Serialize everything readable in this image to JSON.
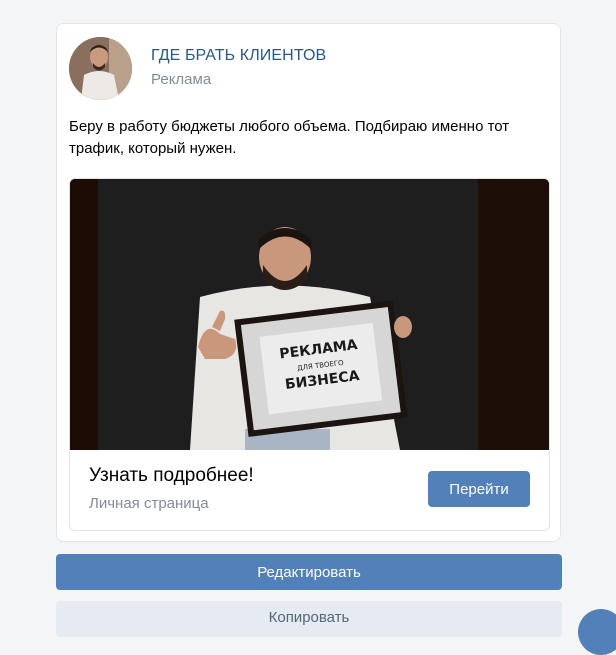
{
  "post": {
    "author": "ГДЕ БРАТЬ КЛИЕНТОВ",
    "label": "Реклама",
    "text": "Беру в работу бюджеты любого объема. Подбираю именно тот трафик, который нужен."
  },
  "ad_image": {
    "sign_line1": "РЕКЛАМА",
    "sign_line2": "ДЛЯ ТВОЕГО",
    "sign_line3": "БИЗНЕСА"
  },
  "cta": {
    "title": "Узнать подробнее!",
    "subtitle": "Личная страница",
    "button": "Перейти"
  },
  "actions": {
    "edit": "Редактировать",
    "copy": "Копировать"
  },
  "colors": {
    "accent": "#5181b8",
    "author_link": "#2a5885",
    "muted": "#818c99"
  }
}
